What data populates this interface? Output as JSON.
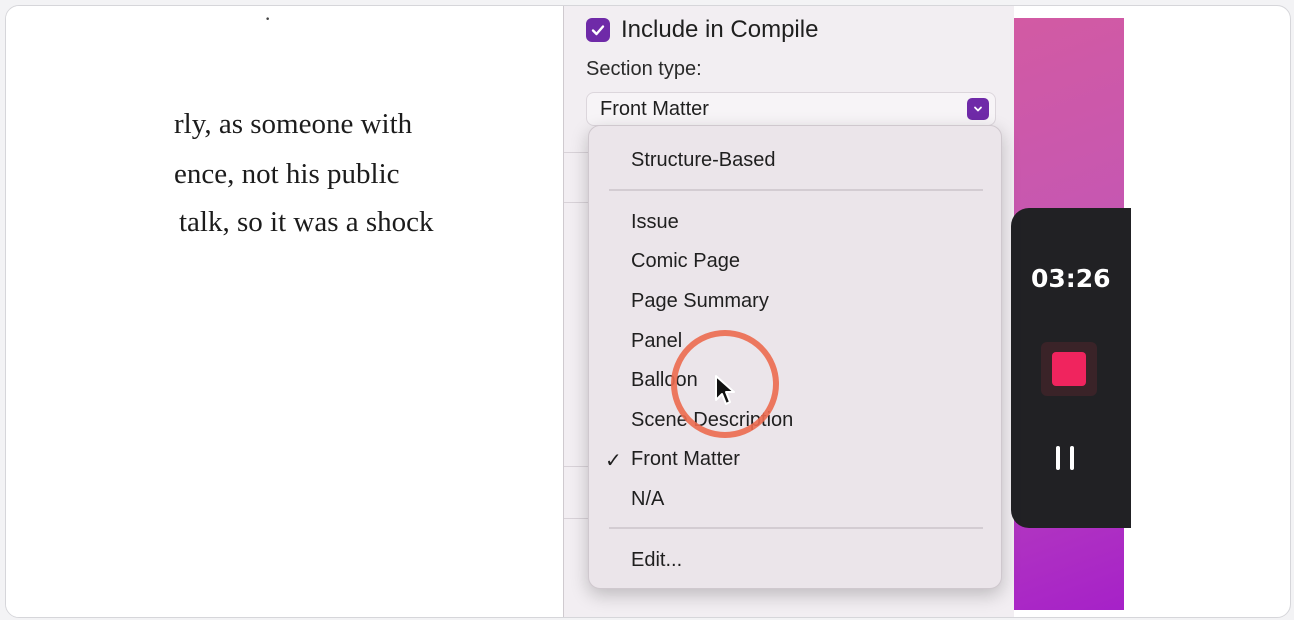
{
  "editor": {
    "lines": [
      "rly, as someone with",
      "ence, not his public",
      "talk, so it was a shock"
    ],
    "top_fragment": "·"
  },
  "inspector": {
    "include_compile_label": "Include in Compile",
    "include_compile_checked": true,
    "section_type_label": "Section type:",
    "section_type_value": "Front Matter"
  },
  "menu": {
    "items": [
      "Structure-Based",
      "Issue",
      "Comic Page",
      "Page Summary",
      "Panel",
      "Balloon",
      "Scene Description",
      "Front Matter",
      "N/A",
      "Edit..."
    ],
    "checked_item": "Front Matter",
    "check_glyph": "✓"
  },
  "recorder": {
    "timer": "03:26"
  },
  "colors": {
    "accent": "#6f2aa8",
    "record": "#f0245e",
    "click_ring": "#ec6a4f"
  }
}
